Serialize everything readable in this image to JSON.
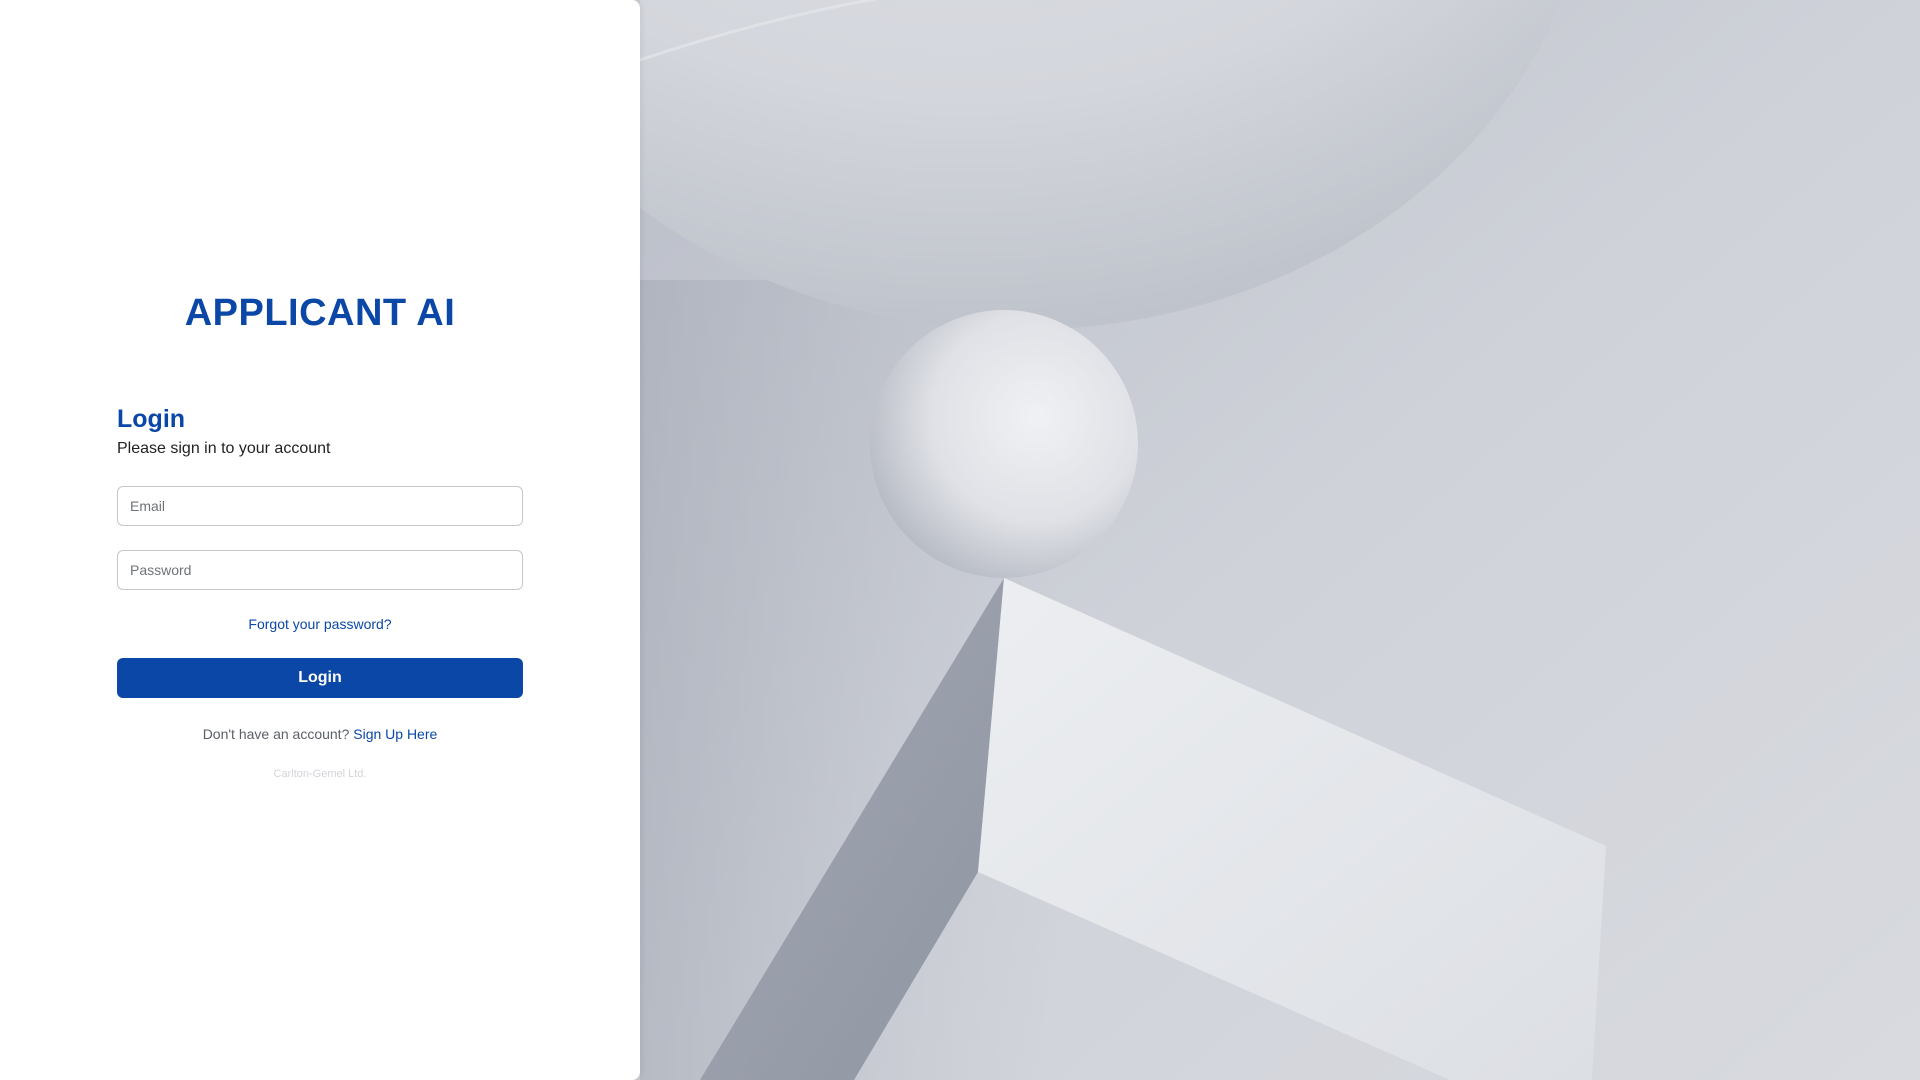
{
  "app": {
    "brand": "APPLICANT AI"
  },
  "login": {
    "title": "Login",
    "subtitle": "Please sign in to your account",
    "email_placeholder": "Email",
    "password_placeholder": "Password",
    "forgot_label": "Forgot your password?",
    "submit_label": "Login",
    "signup_prompt": "Don't have an account?",
    "signup_link": "Sign Up Here",
    "footer": "Carlton-Gemel Ltd."
  },
  "colors": {
    "brand": "#0b47a6",
    "panel_bg": "#ffffff",
    "art_bg": "#c9ccd3"
  }
}
